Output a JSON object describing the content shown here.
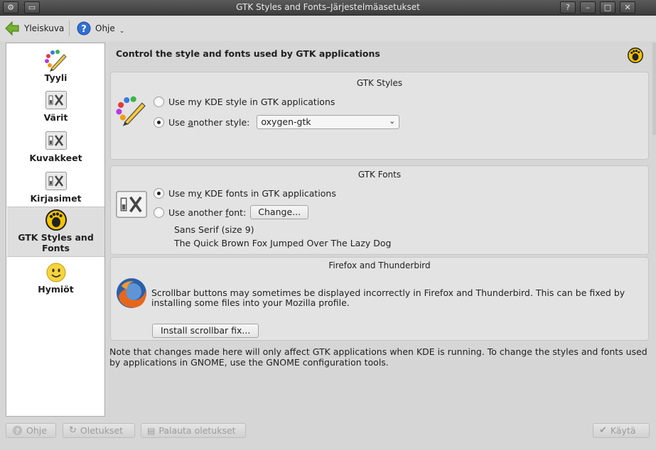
{
  "window": {
    "title": "GTK Styles and Fonts–Järjestelmäasetukset",
    "controls": [
      "?",
      "–",
      "□",
      "✕"
    ]
  },
  "toolbar": {
    "overview_label": "Yleiskuva",
    "help_label": "Ohje"
  },
  "sidebar": {
    "items": [
      {
        "label": "Tyyli",
        "icon": "palette-brush-icon"
      },
      {
        "label": "Värit",
        "icon": "tools-icon"
      },
      {
        "label": "Kuvakkeet",
        "icon": "tools-icon"
      },
      {
        "label": "Kirjasimet",
        "icon": "tools-icon"
      },
      {
        "label": "GTK Styles and Fonts",
        "icon": "gtk-foot-icon",
        "active": true
      },
      {
        "label": "Hymiöt",
        "icon": "smiley-icon"
      }
    ]
  },
  "main": {
    "heading": "Control the style and fonts used by GTK applications"
  },
  "gtk_styles": {
    "title": "GTK Styles",
    "option_kde": "Use my KDE style in GTK applications",
    "option_kde_selected": false,
    "option_other_prefix": "Use ",
    "option_other_underlined": "a",
    "option_other_suffix": "nother style:",
    "option_other_selected": true,
    "style_value": "oxygen-gtk"
  },
  "gtk_fonts": {
    "title": "GTK Fonts",
    "option_kde_prefix": "Use m",
    "option_kde_underlined": "y",
    "option_kde_suffix": " KDE fonts in GTK applications",
    "option_kde_selected": true,
    "option_other_prefix": "Use another ",
    "option_other_underlined": "f",
    "option_other_suffix": "ont:",
    "option_other_selected": false,
    "change_button": "Change...",
    "font_name": "Sans Serif (size 9)",
    "preview_text": "The Quick Brown Fox Jumped Over The Lazy Dog"
  },
  "firefox": {
    "title": "Firefox and Thunderbird",
    "description": "Scrollbar buttons may sometimes be displayed incorrectly in Firefox and Thunderbird.  This can be fixed by installing some files into your Mozilla profile.",
    "install_button": "Install scrollbar fix..."
  },
  "note": "Note that changes made here will only affect GTK applications when KDE is running.  To change the styles and fonts used by applications in GNOME, use the GNOME configuration tools.",
  "bottom": {
    "help": "Ohje",
    "defaults": "Oletukset",
    "reset": "Palauta oletukset",
    "apply": "Käytä"
  },
  "colors": {
    "accent_green": "#6fae2a",
    "help_blue": "#2f6fd6",
    "gtk_yellow": "#f3c400",
    "smiley_yellow": "#f7d43c"
  }
}
